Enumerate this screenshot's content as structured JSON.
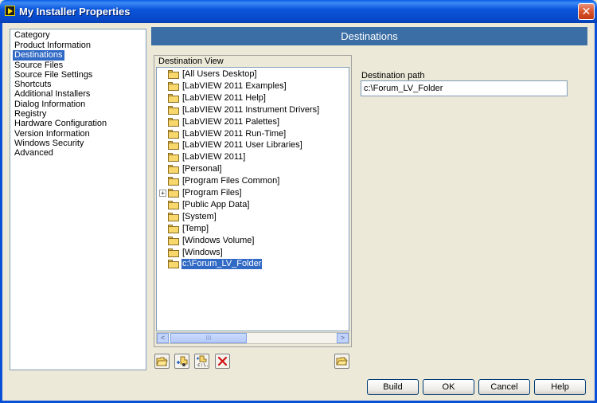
{
  "window": {
    "title": "My Installer Properties",
    "close_glyph": "✕"
  },
  "category": {
    "header": "Category",
    "items": [
      {
        "label": "Product Information",
        "selected": false
      },
      {
        "label": "Destinations",
        "selected": true
      },
      {
        "label": "Source Files",
        "selected": false
      },
      {
        "label": "Source File Settings",
        "selected": false
      },
      {
        "label": "Shortcuts",
        "selected": false
      },
      {
        "label": "Additional Installers",
        "selected": false
      },
      {
        "label": "Dialog Information",
        "selected": false
      },
      {
        "label": "Registry",
        "selected": false
      },
      {
        "label": "Hardware Configuration",
        "selected": false
      },
      {
        "label": "Version Information",
        "selected": false
      },
      {
        "label": "Windows Security",
        "selected": false
      },
      {
        "label": "Advanced",
        "selected": false
      }
    ]
  },
  "section_title": "Destinations",
  "destination_view": {
    "label": "Destination View",
    "items": [
      {
        "label": "[All Users Desktop]",
        "expandable": false,
        "selected": false
      },
      {
        "label": "[LabVIEW 2011 Examples]",
        "expandable": false,
        "selected": false
      },
      {
        "label": "[LabVIEW 2011 Help]",
        "expandable": false,
        "selected": false
      },
      {
        "label": "[LabVIEW 2011 Instrument Drivers]",
        "expandable": false,
        "selected": false
      },
      {
        "label": "[LabVIEW 2011 Palettes]",
        "expandable": false,
        "selected": false
      },
      {
        "label": "[LabVIEW 2011 Run-Time]",
        "expandable": false,
        "selected": false
      },
      {
        "label": "[LabVIEW 2011 User Libraries]",
        "expandable": false,
        "selected": false
      },
      {
        "label": "[LabVIEW 2011]",
        "expandable": false,
        "selected": false
      },
      {
        "label": "[Personal]",
        "expandable": false,
        "selected": false
      },
      {
        "label": "[Program Files Common]",
        "expandable": false,
        "selected": false
      },
      {
        "label": "[Program Files]",
        "expandable": true,
        "selected": false
      },
      {
        "label": "[Public App Data]",
        "expandable": false,
        "selected": false
      },
      {
        "label": "[System]",
        "expandable": false,
        "selected": false
      },
      {
        "label": "[Temp]",
        "expandable": false,
        "selected": false
      },
      {
        "label": "[Windows Volume]",
        "expandable": false,
        "selected": false
      },
      {
        "label": "[Windows]",
        "expandable": false,
        "selected": false
      },
      {
        "label": "c:\\Forum_LV_Folder",
        "expandable": false,
        "selected": true
      }
    ],
    "scroll": {
      "left_glyph": "<",
      "right_glyph": ">",
      "thumb_glyph": "III"
    },
    "toolbar": [
      {
        "name": "add-folder-button",
        "icon": "new-folder-icon"
      },
      {
        "name": "add-custom-destination-button",
        "icon": "add-destination-icon"
      },
      {
        "name": "add-path-destination-button",
        "icon": "add-path-icon"
      },
      {
        "name": "delete-destination-button",
        "icon": "delete-icon"
      },
      {
        "name": "browse-folder-button",
        "icon": "open-folder-icon"
      }
    ]
  },
  "destination_path": {
    "label": "Destination path",
    "value": "c:\\Forum_LV_Folder"
  },
  "buttons": {
    "build": "Build",
    "ok": "OK",
    "cancel": "Cancel",
    "help": "Help"
  },
  "colors": {
    "titlebar": "#0b55dc",
    "selection": "#316ac5",
    "banner": "#3a6ea5",
    "dialog_bg": "#ece9d8"
  }
}
